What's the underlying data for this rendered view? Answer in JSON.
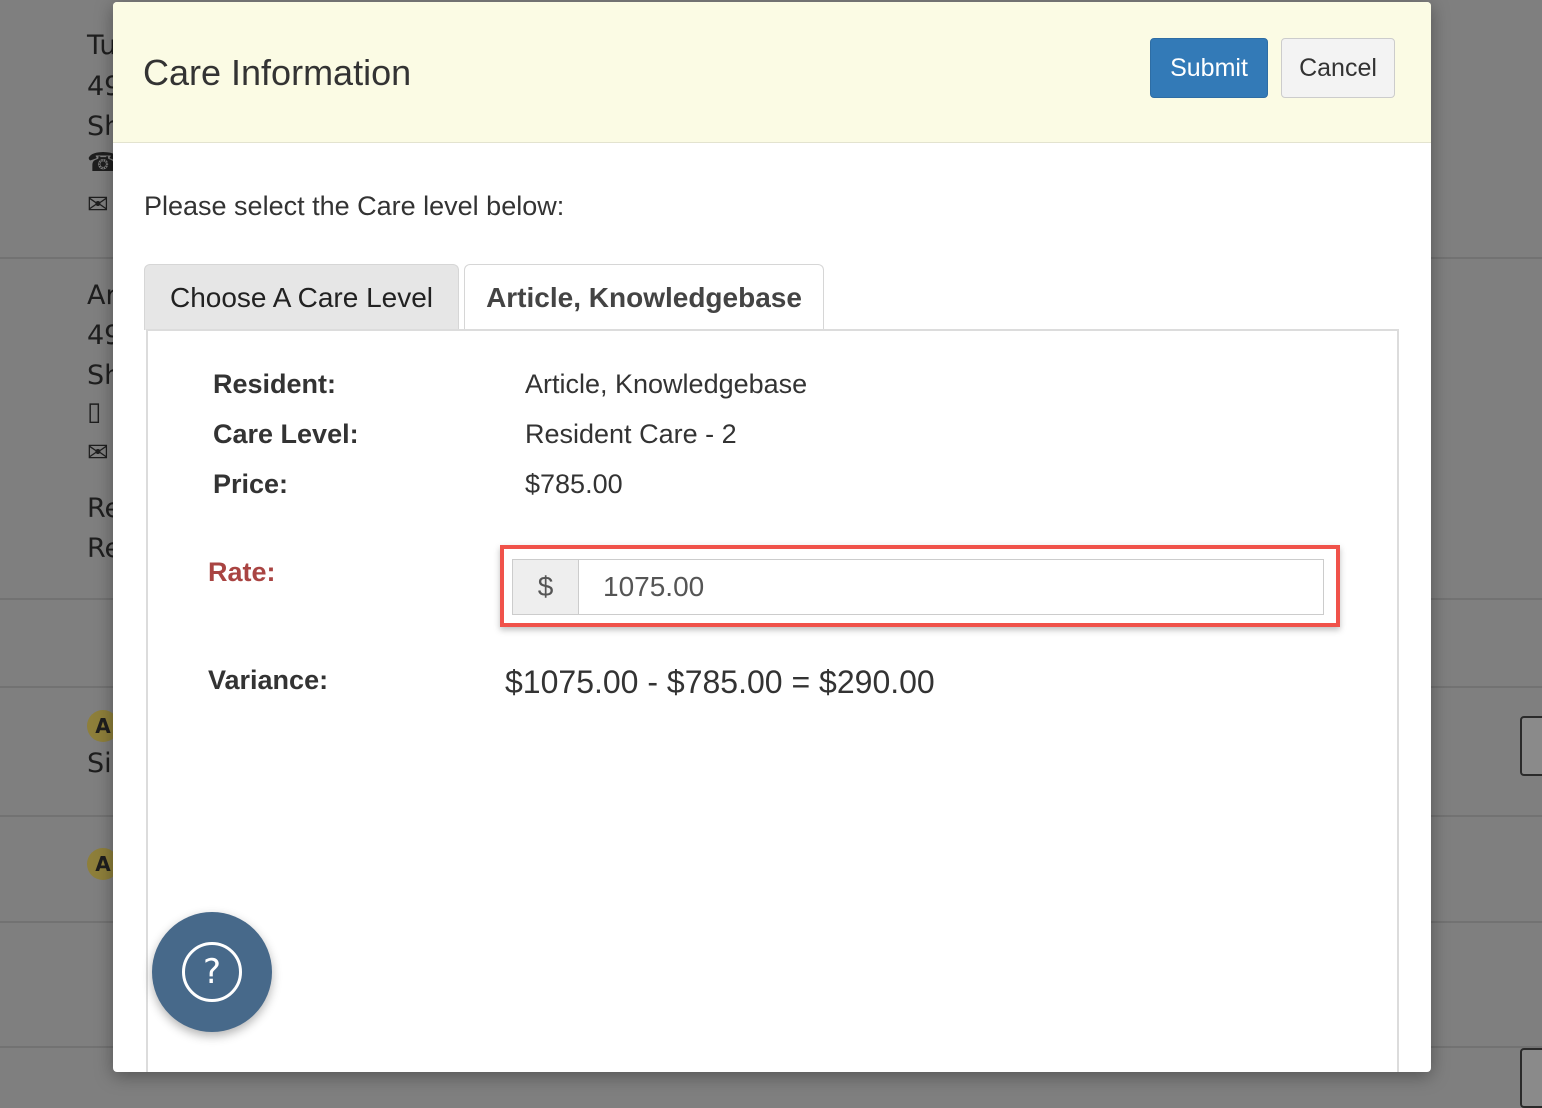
{
  "background": {
    "fragments": [
      {
        "text": "Tu"
      },
      {
        "text": "49"
      },
      {
        "text": "Sh"
      },
      {
        "text": "Ar"
      },
      {
        "text": "49"
      },
      {
        "text": "Sh"
      },
      {
        "text": "Re"
      },
      {
        "text": "Re"
      },
      {
        "text": "Si"
      }
    ],
    "badges": [
      "A",
      "A"
    ],
    "icons": [
      "phone-icon",
      "envelope-icon",
      "mobile-icon",
      "envelope-icon"
    ]
  },
  "modal": {
    "title": "Care Information",
    "submit_label": "Submit",
    "cancel_label": "Cancel",
    "intro": "Please select the Care level below:",
    "tabs": [
      {
        "label": "Choose A Care Level",
        "active": false
      },
      {
        "label": "Article, Knowledgebase",
        "active": true
      }
    ],
    "details": {
      "resident_label": "Resident:",
      "resident_value": "Article, Knowledgebase",
      "care_level_label": "Care Level:",
      "care_level_value": "Resident Care - 2",
      "price_label": "Price:",
      "price_value": "$785.00"
    },
    "rate": {
      "label": "Rate:",
      "currency": "$",
      "value": "1075.00"
    },
    "variance": {
      "label": "Variance:",
      "value": "$1075.00 - $785.00 = $290.00"
    }
  },
  "help": {
    "glyph": "?"
  },
  "colors": {
    "header_bg": "#fbfbe4",
    "submit_bg": "#337ab7",
    "rate_label": "#a94442",
    "highlight": "#f0524a",
    "help_bg": "#47698a"
  }
}
